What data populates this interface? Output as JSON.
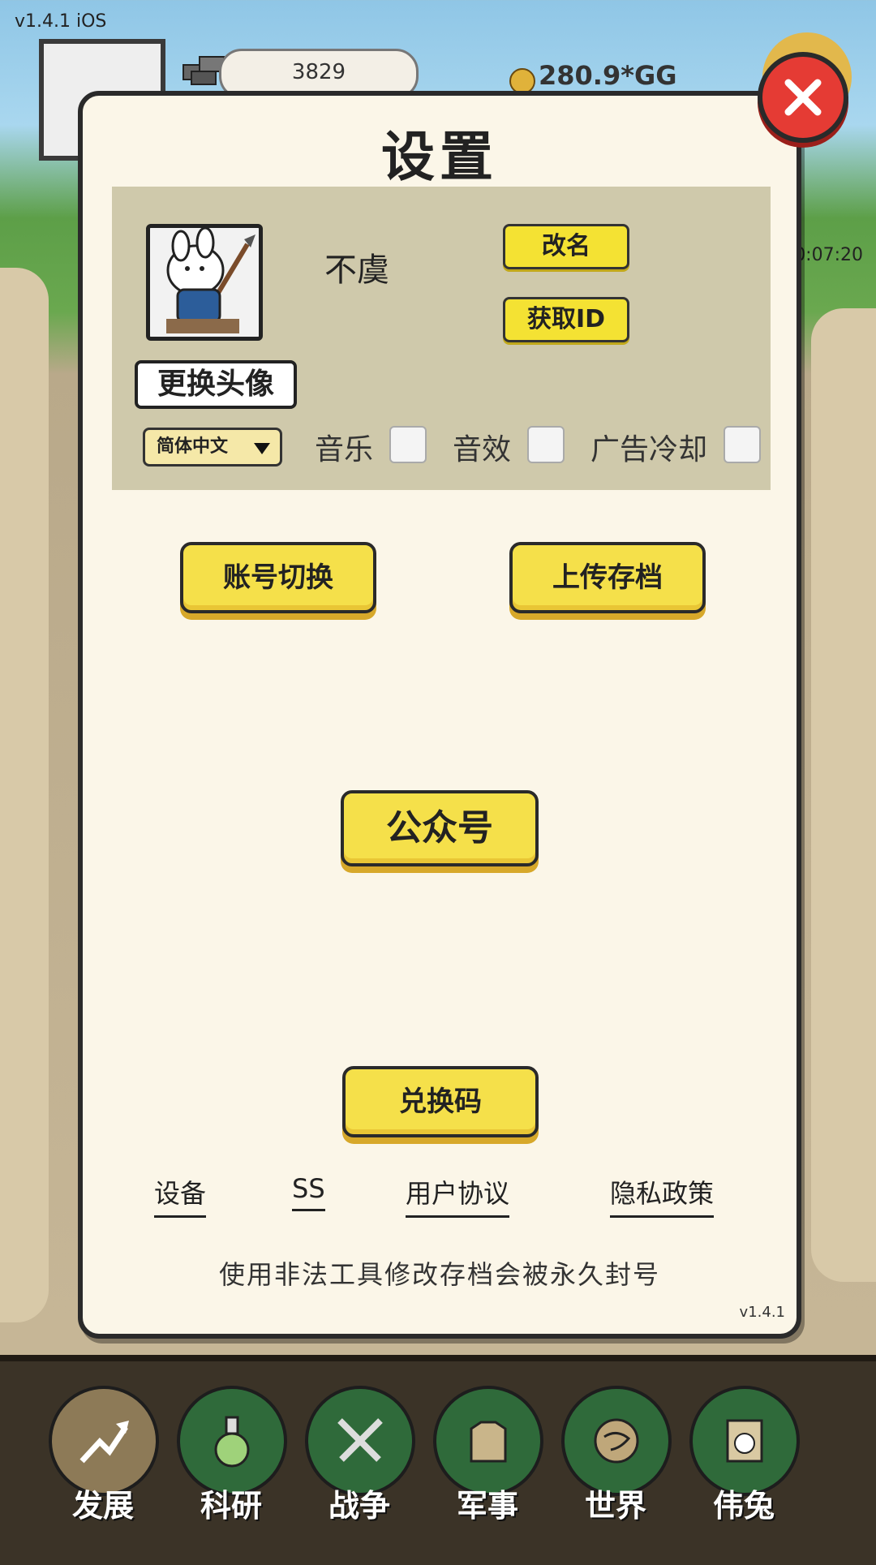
{
  "status": {
    "version": "v1.4.1 iOS"
  },
  "hud": {
    "stone_value": "3829",
    "gold_value": "280.9*GG",
    "side_time": "0:07:20"
  },
  "dialog": {
    "title": "设置",
    "profile": {
      "username": "不虞",
      "change_avatar": "更换头像",
      "rename": "改名",
      "get_id": "获取ID",
      "language": "简体中文",
      "music": "音乐",
      "sound": "音效",
      "ad_cooldown": "广告冷却"
    },
    "buttons": {
      "switch_account": "账号切换",
      "upload_save": "上传存档",
      "official_account": "公众号",
      "redeem_code": "兑换码"
    },
    "links": {
      "device": "设备",
      "ss": "SS",
      "user_agreement": "用户协议",
      "privacy_policy": "隐私政策"
    },
    "warning": "使用非法工具修改存档会被永久封号",
    "version": "v1.4.1"
  },
  "nav": [
    "发展",
    "科研",
    "战争",
    "军事",
    "世界",
    "伟兔"
  ],
  "colors": {
    "accent_yellow": "#f5e04a",
    "close_red": "#e53b34",
    "panel": "#fbf6e8",
    "profile_bg": "#cfc9ab"
  },
  "icons": [
    "close-icon",
    "develop-icon",
    "flask-icon",
    "swords-icon",
    "coat-icon",
    "globe-icon",
    "rabbit-icon"
  ]
}
